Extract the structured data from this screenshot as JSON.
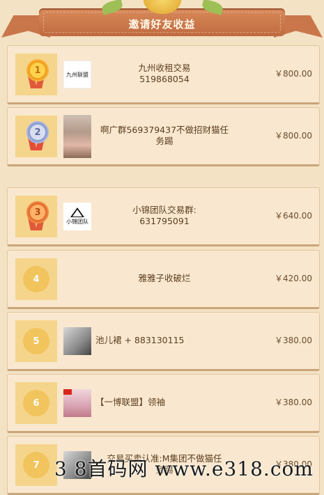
{
  "header": {
    "title": "邀请好友收益"
  },
  "rows": [
    {
      "rank": "1",
      "name_line1": "九州收租交易",
      "name_line2": "519868054",
      "amount": "￥800.00",
      "avatar_text": "九州联盟"
    },
    {
      "rank": "2",
      "name_line1": "啊广群569379437不做招财猫任",
      "name_line2": "务踢",
      "amount": "￥800.00"
    },
    {
      "rank": "3",
      "name_line1": "小锦团队交易群:",
      "name_line2": "631795091",
      "amount": "￥640.00",
      "avatar_text": "小锦团队"
    },
    {
      "rank": "4",
      "name_line1": "雅雅子收破烂",
      "name_line2": "",
      "amount": "￥420.00"
    },
    {
      "rank": "5",
      "name_line1": "池儿裙 + 883130115",
      "name_line2": "",
      "amount": "￥380.00"
    },
    {
      "rank": "6",
      "name_line1": "【一博联盟】领袖",
      "name_line2": "",
      "amount": "￥380.00"
    },
    {
      "rank": "7",
      "name_line1": "交易买卖认准:M集团不做猫任",
      "name_line2": "务踢",
      "amount": "￥380.00"
    }
  ],
  "watermark": "3 8首码网 www.e318.com",
  "icons": {
    "rank1": "gold-medal-icon",
    "rank2": "silver-medal-icon",
    "rank3": "bronze-medal-icon"
  }
}
